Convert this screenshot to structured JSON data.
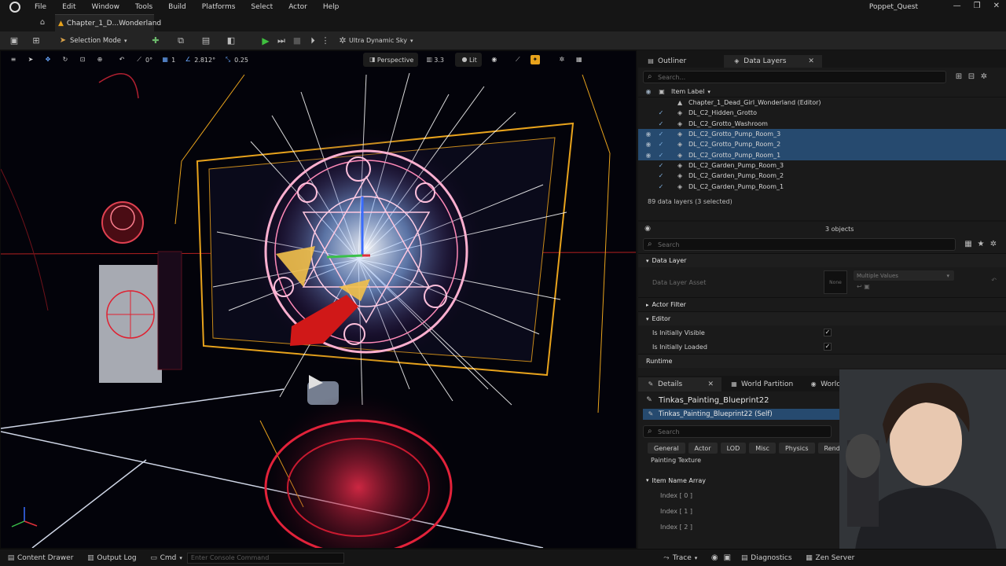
{
  "menubar": {
    "items": [
      "File",
      "Edit",
      "Window",
      "Tools",
      "Build",
      "Platforms",
      "Select",
      "Actor",
      "Help"
    ],
    "project_name": "Poppet_Quest"
  },
  "level_tab": {
    "label": "Chapter_1_D...Wonderland"
  },
  "toolbar": {
    "selection_mode": "Selection Mode",
    "sky_label": "Ultra Dynamic Sky"
  },
  "viewport": {
    "snap_rotation": "0°",
    "snap_grid": "1",
    "camera_speed_scale": "2.812°",
    "scale_snap": "0.25",
    "perspective": "Perspective",
    "fov": "3.3",
    "view_mode": "Lit"
  },
  "outliner": {
    "tab_outliner": "Outliner",
    "tab_data_layers": "Data Layers",
    "search_placeholder": "Search...",
    "column_label": "Item Label",
    "root": "Chapter_1_Dead_Girl_Wonderland (Editor)",
    "rows": [
      {
        "label": "DL_C2_Hidden_Grotto",
        "selected": false
      },
      {
        "label": "DL_C2_Grotto_Washroom",
        "selected": false
      },
      {
        "label": "DL_C2_Grotto_Pump_Room_3",
        "selected": true
      },
      {
        "label": "DL_C2_Grotto_Pump_Room_2",
        "selected": true
      },
      {
        "label": "DL_C2_Grotto_Pump_Room_1",
        "selected": true
      },
      {
        "label": "DL_C2_Garden_Pump_Room_3",
        "selected": false
      },
      {
        "label": "DL_C2_Garden_Pump_Room_2",
        "selected": false
      },
      {
        "label": "DL_C2_Garden_Pump_Room_1",
        "selected": false
      }
    ],
    "footer": "89 data layers (3 selected)"
  },
  "layer_details": {
    "objects_count": "3 objects",
    "search_placeholder": "Search",
    "section_data_layer": "Data Layer",
    "data_layer_asset_label": "Data Layer Asset",
    "asset_thumb": "None",
    "asset_value": "Multiple Values",
    "section_actor_filter": "Actor Filter",
    "section_editor": "Editor",
    "is_initially_visible": "Is Initially Visible",
    "is_initially_loaded": "Is Initially Loaded",
    "section_runtime": "Runtime"
  },
  "details": {
    "tab_details": "Details",
    "tab_world_partition": "World Partition",
    "tab_world_settings": "World Settings",
    "actor_name": "Tinkas_Painting_Blueprint22",
    "self_row": "Tinkas_Painting_Blueprint22 (Self)",
    "search_placeholder": "Search",
    "categories": [
      "General",
      "Actor",
      "LOD",
      "Misc",
      "Physics",
      "Renderi"
    ],
    "painting_texture": "Painting Texture",
    "item_name_array": "Item Name Array",
    "indices": [
      "Index [ 0 ]",
      "Index [ 1 ]",
      "Index [ 2 ]"
    ]
  },
  "statusbar": {
    "content_drawer": "Content Drawer",
    "output_log": "Output Log",
    "cmd": "Cmd",
    "console_placeholder": "Enter Console Command",
    "trace": "Trace",
    "diagnostics": "Diagnostics",
    "zen_server": "Zen Server"
  },
  "colors": {
    "selection": "#264a6f",
    "play": "#3fbf3f",
    "accent_orange": "#e8a31c"
  }
}
